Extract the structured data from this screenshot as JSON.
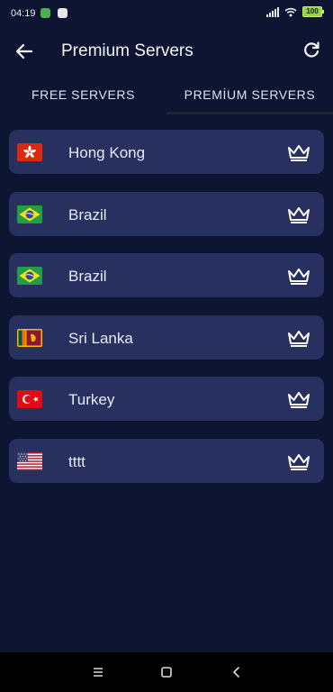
{
  "status_bar": {
    "time": "04:19",
    "battery": "100"
  },
  "app_bar": {
    "title": "Premium Servers"
  },
  "tabs": [
    {
      "label": "FREE SERVERS",
      "selected": false
    },
    {
      "label": "PREMİUM SERVERS",
      "selected": true
    }
  ],
  "servers": [
    {
      "name": "Hong Kong",
      "flag": "hong-kong-flag-icon",
      "badge": "crown-icon"
    },
    {
      "name": "Brazil",
      "flag": "brazil-flag-icon",
      "badge": "crown-icon"
    },
    {
      "name": "Brazil",
      "flag": "brazil-flag-icon",
      "badge": "crown-icon"
    },
    {
      "name": "Sri Lanka",
      "flag": "sri-lanka-flag-icon",
      "badge": "crown-icon"
    },
    {
      "name": "Turkey",
      "flag": "turkey-flag-icon",
      "badge": "crown-icon"
    },
    {
      "name": "tttt",
      "flag": "usa-flag-icon",
      "badge": "crown-icon"
    }
  ],
  "colors": {
    "background": "#0d1533",
    "card": "#27305e",
    "text": "#e8ebf5"
  }
}
